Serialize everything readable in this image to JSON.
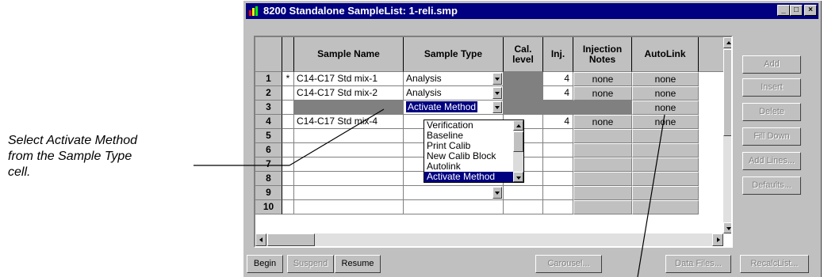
{
  "callout": {
    "line1": "Select Activate Method",
    "line2": "from the Sample Type",
    "line3": "cell."
  },
  "window": {
    "title": "8200 Standalone SampleList: 1-reli.smp",
    "minimize": "_",
    "maximize": "□",
    "close": "×"
  },
  "grid": {
    "columns": {
      "sample_name": "Sample Name",
      "sample_type": "Sample Type",
      "cal_level": "Cal. level",
      "inj": "Inj.",
      "injection_notes": "Injection Notes",
      "autolink": "AutoLink"
    },
    "rows": [
      {
        "num": "1",
        "marker": "*",
        "name": "C14-C17 Std mix-1",
        "type": "Analysis",
        "inj": "4",
        "notes": "none",
        "autolink": "none"
      },
      {
        "num": "2",
        "marker": "",
        "name": "C14-C17 Std mix-2",
        "type": "Analysis",
        "inj": "4",
        "notes": "none",
        "autolink": "none"
      },
      {
        "num": "3",
        "marker": "",
        "name": "",
        "type": "Activate Method",
        "inj": "",
        "notes": "",
        "autolink": "none"
      },
      {
        "num": "4",
        "marker": "",
        "name": "C14-C17 Std mix-4",
        "type": "",
        "inj": "4",
        "notes": "none",
        "autolink": "none"
      },
      {
        "num": "5"
      },
      {
        "num": "6"
      },
      {
        "num": "7"
      },
      {
        "num": "8"
      },
      {
        "num": "9"
      },
      {
        "num": "10"
      }
    ],
    "dropdown_options": [
      "Verification",
      "Baseline",
      "Print Calib",
      "New Calib Block",
      "Autolink",
      "Activate Method"
    ],
    "dropdown_selected": "Activate Method"
  },
  "side_buttons": {
    "add": "Add",
    "insert": "Insert",
    "delete": "Delete",
    "fill_down": "Fill Down",
    "add_lines": "Add Lines...",
    "defaults": "Defaults..."
  },
  "bottom_buttons": {
    "begin": "Begin",
    "suspend": "Suspend",
    "resume": "Resume",
    "carousel": "Carousel...",
    "data_files": "Data Files...",
    "recalc_list": "RecalcList..."
  },
  "colors": {
    "titlebar": "#000080",
    "face": "#c0c0c0",
    "selection": "#000080",
    "disabled_cell": "#808080"
  }
}
